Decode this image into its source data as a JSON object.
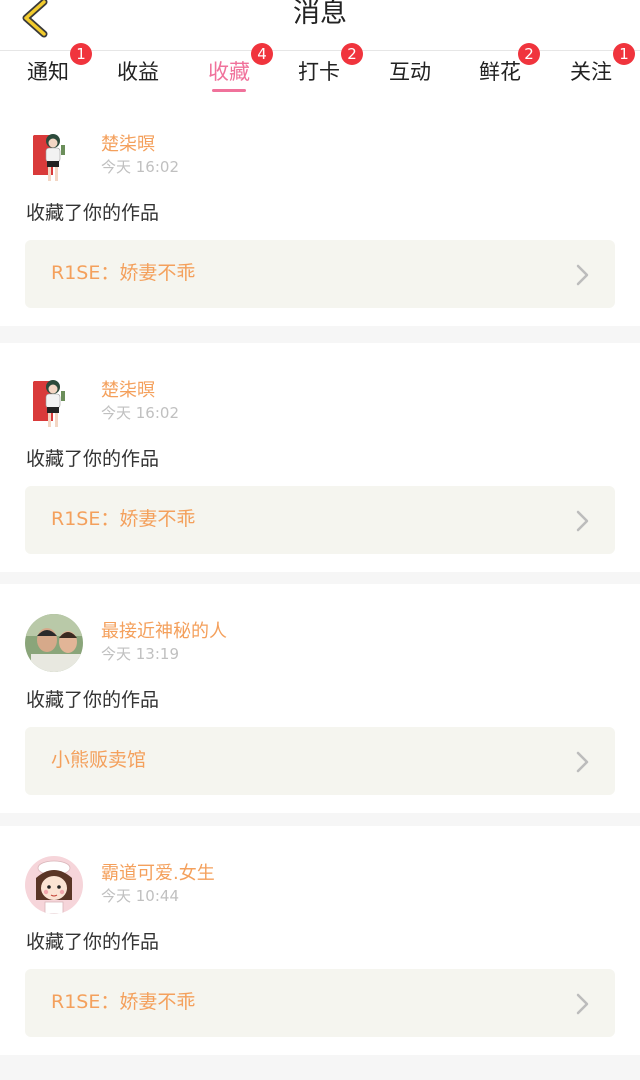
{
  "header": {
    "title": "消息"
  },
  "tabs": [
    {
      "label": "通知",
      "badge": "1",
      "active": false
    },
    {
      "label": "收益",
      "badge": "",
      "active": false
    },
    {
      "label": "收藏",
      "badge": "4",
      "active": true
    },
    {
      "label": "打卡",
      "badge": "2",
      "active": false
    },
    {
      "label": "互动",
      "badge": "",
      "active": false
    },
    {
      "label": "鲜花",
      "badge": "2",
      "active": false
    },
    {
      "label": "关注",
      "badge": "1",
      "active": false
    }
  ],
  "colors": {
    "accent_pink": "#f0729b",
    "username_orange": "#f4a05c",
    "badge_red": "#f0343d",
    "work_box_bg": "#f5f5ef",
    "back_arrow": "#f2cb2d"
  },
  "messages": [
    {
      "user": "楚柒暝",
      "time": "今天 16:02",
      "action": "收藏了你的作品",
      "work": "R1SE：娇妻不乖",
      "avatar_icon": "anime-girl-avatar"
    },
    {
      "user": "楚柒暝",
      "time": "今天 16:02",
      "action": "收藏了你的作品",
      "work": "R1SE：娇妻不乖",
      "avatar_icon": "anime-girl-avatar"
    },
    {
      "user": "最接近神秘的人",
      "time": "今天 13:19",
      "action": "收藏了你的作品",
      "work": "小熊贩卖馆",
      "avatar_icon": "couple-photo-avatar"
    },
    {
      "user": "霸道可爱.女生",
      "time": "今天 10:44",
      "action": "收藏了你的作品",
      "work": "R1SE：娇妻不乖",
      "avatar_icon": "cartoon-chef-girl-avatar"
    }
  ]
}
